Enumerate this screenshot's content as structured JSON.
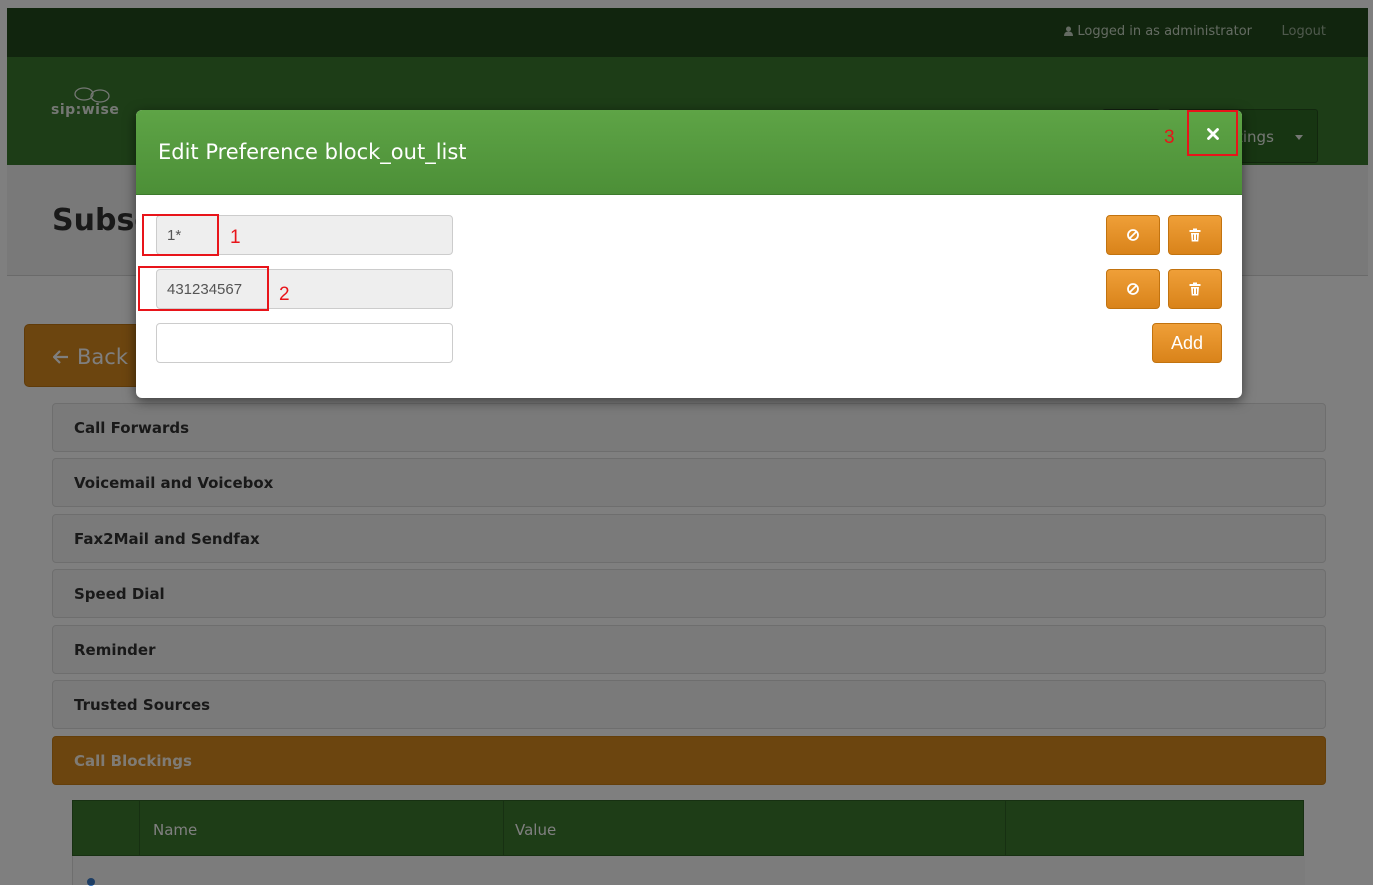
{
  "topbar": {
    "user_text": "Logged in as administrator",
    "logout": "Logout"
  },
  "navbar": {
    "logo_text": "sip:wise",
    "settings_label": "tings"
  },
  "page": {
    "title": "Subsc",
    "back_label": "Back"
  },
  "accordion": [
    {
      "label": "Call Forwards",
      "active": false
    },
    {
      "label": "Voicemail and Voicebox",
      "active": false
    },
    {
      "label": "Fax2Mail and Sendfax",
      "active": false
    },
    {
      "label": "Speed Dial",
      "active": false
    },
    {
      "label": "Reminder",
      "active": false
    },
    {
      "label": "Trusted Sources",
      "active": false
    },
    {
      "label": "Call Blockings",
      "active": true
    }
  ],
  "table": {
    "columns": [
      "Name",
      "Value"
    ]
  },
  "modal": {
    "title": "Edit Preference block_out_list",
    "entries": [
      "1*",
      "431234567"
    ],
    "new_entry": "",
    "add_label": "Add"
  },
  "annotations": [
    "1",
    "2",
    "3"
  ],
  "colors": {
    "header_green": "#4c8f37",
    "button_orange": "#d9831a",
    "annotation_red": "#e8141a"
  },
  "icons": [
    "user-icon",
    "logo-icon",
    "caret-down-icon",
    "arrow-left-icon",
    "close-icon",
    "block-icon",
    "trash-icon"
  ]
}
